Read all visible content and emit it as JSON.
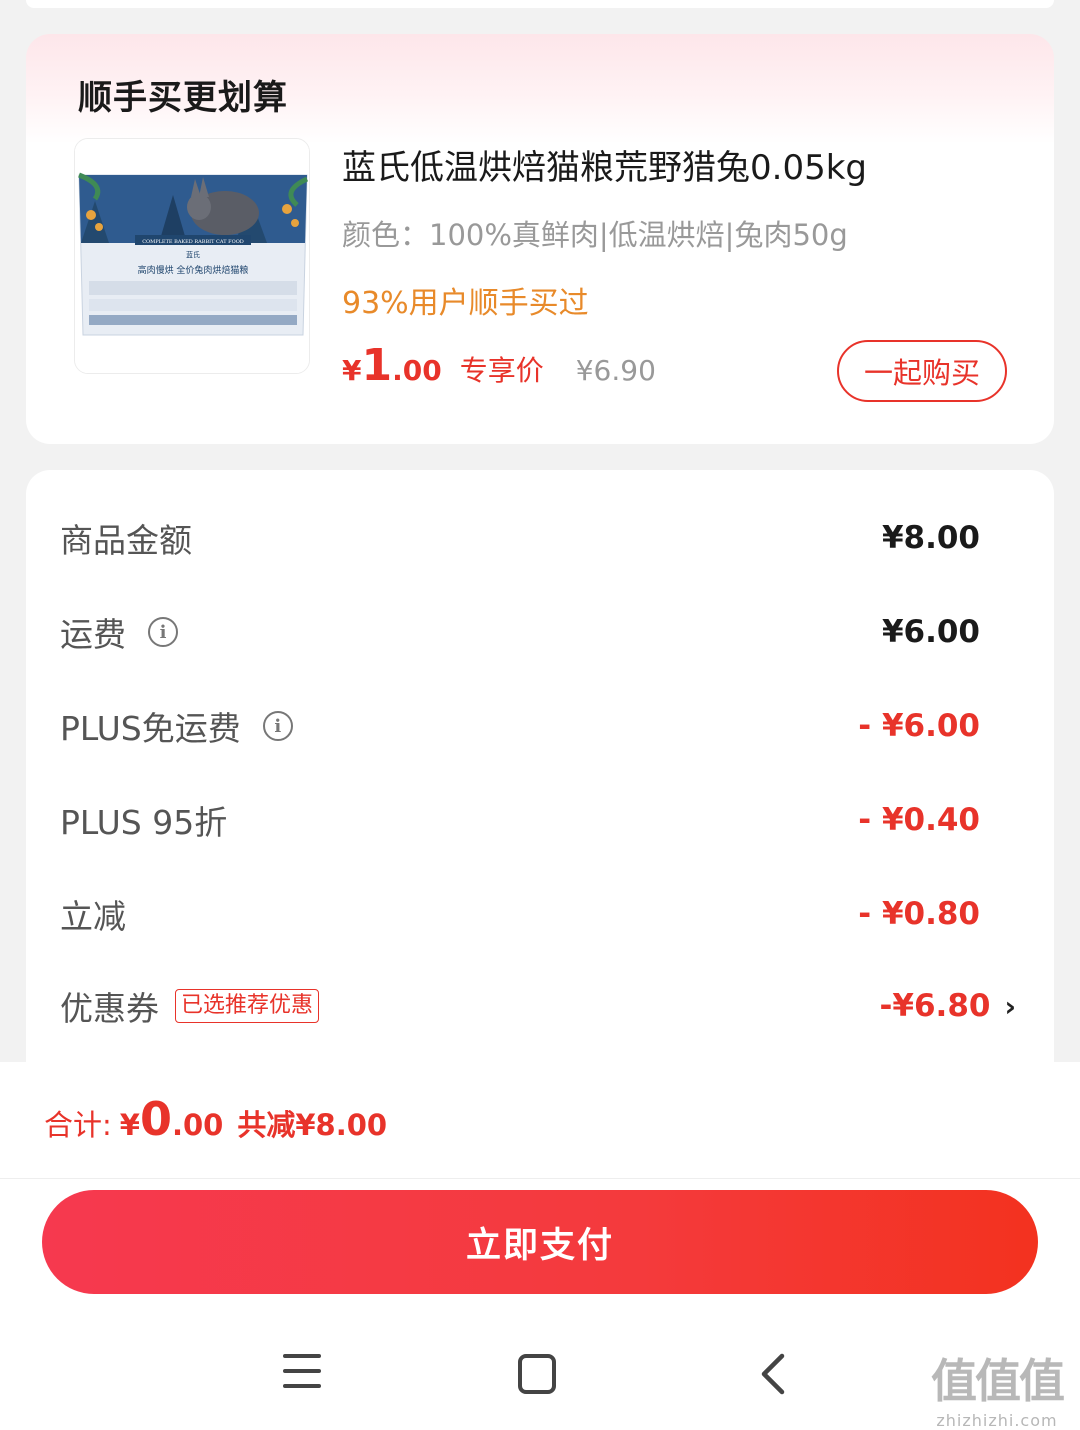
{
  "addon": {
    "title": "顺手买更划算",
    "product": {
      "name": "蓝氏低温烘焙猫粮荒野猎兔0.05kg",
      "spec": "颜色：100%真鲜肉|低温烘焙|兔肉50g",
      "social_proof": "93%用户顺手买过",
      "price_currency": "¥",
      "price_int": "1",
      "price_dec": ".00",
      "price_tag": "专享价",
      "original_price": "¥6.90",
      "buy_button": "一起购买",
      "package_text": {
        "headline": "COMPLETE BAKED RABBIT CAT FOOD",
        "brand": "蓝氏",
        "name": "高肉慢烘 全价兔肉烘焙猫粮"
      }
    }
  },
  "summary": {
    "rows": [
      {
        "label": "商品金额",
        "value": "¥8.00"
      },
      {
        "label": "运费",
        "value": "¥6.00"
      },
      {
        "label": "PLUS免运费",
        "value": "- ¥6.00"
      },
      {
        "label": "PLUS 95折",
        "value": "- ¥0.40"
      },
      {
        "label": "立减",
        "value": "- ¥0.80"
      },
      {
        "label": "优惠券",
        "badge": "已选推荐优惠",
        "value": "-¥6.80"
      }
    ]
  },
  "footer": {
    "total_label": "合计:",
    "total_currency": "¥",
    "total_int": "0",
    "total_dec": ".00",
    "total_saved": "共减¥8.00",
    "pay_button": "立即支付"
  },
  "watermark": {
    "logo": "值值值",
    "url": "zhizhizhi.com"
  },
  "colors": {
    "accent_red": "#e8332a",
    "orange": "#e88a2a",
    "background": "#f2f2f2"
  }
}
